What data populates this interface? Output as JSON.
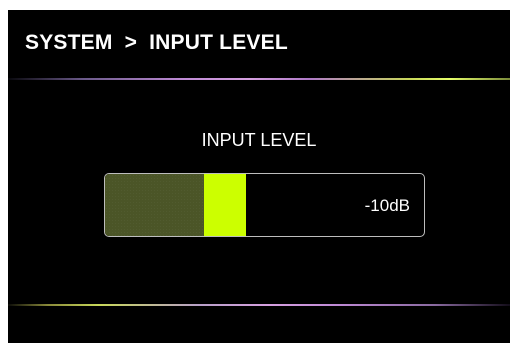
{
  "header": {
    "title": "SYSTEM  >  INPUT LEVEL"
  },
  "main": {
    "label": "INPUT LEVEL",
    "meter": {
      "value_text": "-10dB",
      "level_fraction": 0.31,
      "fill_color": "#4b5527",
      "indicator_color": "#ccff00"
    }
  },
  "colors": {
    "background": "#000000",
    "text": "#ffffff",
    "meter_border": "#bdbdbd"
  }
}
